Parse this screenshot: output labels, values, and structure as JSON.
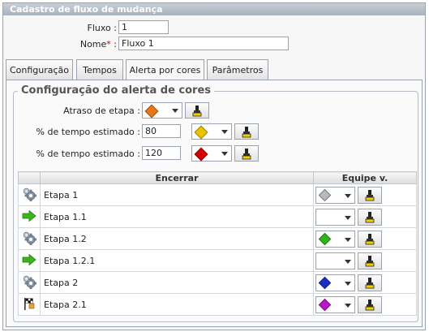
{
  "title": "Cadastro de fluxo de mudança",
  "form": {
    "fluxo_label": "Fluxo :",
    "fluxo_value": "1",
    "nome_label": "Nome",
    "nome_required": "*",
    "nome_colon": " :",
    "nome_value": "Fluxo 1"
  },
  "tabs": [
    {
      "label": "Configuração",
      "active": false
    },
    {
      "label": "Tempos",
      "active": false
    },
    {
      "label": "Alerta por cores",
      "active": true
    },
    {
      "label": "Parâmetros",
      "active": false
    }
  ],
  "alert": {
    "legend": "Configuração do alerta de cores",
    "atraso_label": "Atraso de etapa :",
    "atraso_color": "#e8771a",
    "tempo1_label": "% de tempo estimado :",
    "tempo1_value": "80",
    "tempo1_color": "#e9c400",
    "tempo2_label": "% de tempo estimado :",
    "tempo2_value": "120",
    "tempo2_color": "#d40000"
  },
  "grid": {
    "col_encerrar": "Encerrar",
    "col_equipe": "Equipe v.",
    "rows": [
      {
        "icon": "gear-icon",
        "name": "Etapa 1",
        "color": "#b8b8b8"
      },
      {
        "icon": "arrow-right-icon",
        "name": "Etapa 1.1",
        "color": ""
      },
      {
        "icon": "gear-icon",
        "name": "Etapa 1.2",
        "color": "#2fb51a"
      },
      {
        "icon": "arrow-right-icon",
        "name": "Etapa 1.2.1",
        "color": ""
      },
      {
        "icon": "gear-icon",
        "name": "Etapa 2",
        "color": "#1a2fc4"
      },
      {
        "icon": "flag-icon",
        "name": "Etapa 2.1",
        "color": "#b51ac4"
      }
    ]
  }
}
